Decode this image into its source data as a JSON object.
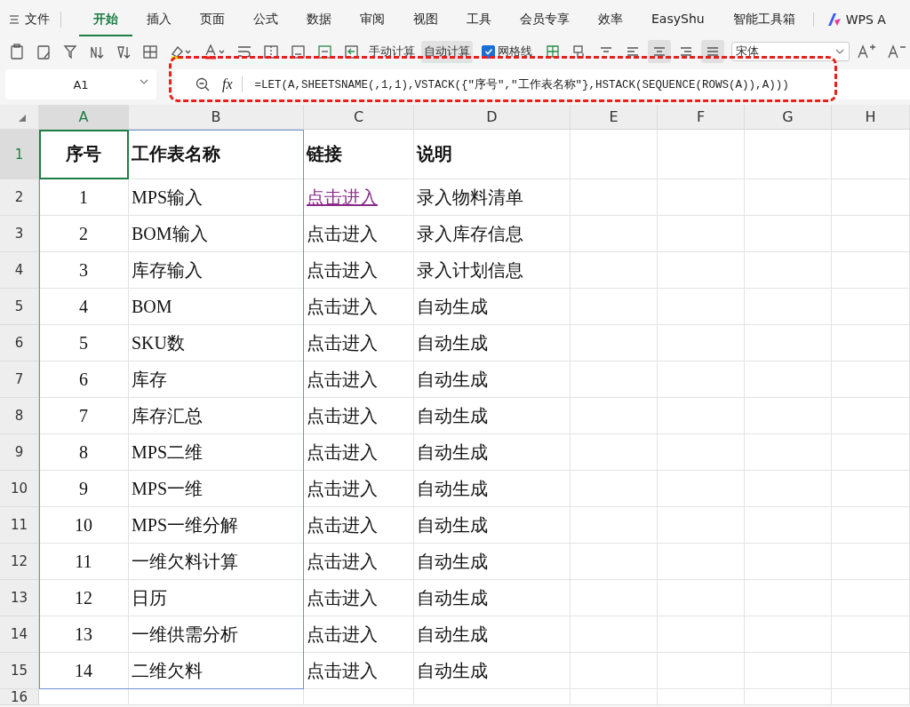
{
  "menu": {
    "file_label": "文件",
    "tabs": [
      {
        "label": "开始",
        "selected": true
      },
      {
        "label": "插入",
        "selected": false
      },
      {
        "label": "页面",
        "selected": false
      },
      {
        "label": "公式",
        "selected": false
      },
      {
        "label": "数据",
        "selected": false
      },
      {
        "label": "审阅",
        "selected": false
      },
      {
        "label": "视图",
        "selected": false
      },
      {
        "label": "工具",
        "selected": false
      },
      {
        "label": "会员专享",
        "selected": false
      },
      {
        "label": "效率",
        "selected": false
      },
      {
        "label": "EasyShu",
        "selected": false
      },
      {
        "label": "智能工具箱",
        "selected": false
      }
    ],
    "brand": "WPS A"
  },
  "toolbar": {
    "calc_buttons": [
      {
        "label": "手动计算",
        "selected": false
      },
      {
        "label": "自动计算",
        "selected": true
      }
    ],
    "gridlines": {
      "label": "网格线",
      "checked": true
    },
    "font": {
      "value": "宋体"
    }
  },
  "formula_bar": {
    "cell_ref": "A1",
    "fx_label": "fx",
    "formula": "=LET(A,SHEETSNAME(,1,1),VSTACK({\"序号\",\"工作表名称\"},HSTACK(SEQUENCE(ROWS(A)),A)))"
  },
  "annotation": {
    "kind": "dashed-outline"
  },
  "sheet": {
    "columns": [
      {
        "label": "A",
        "selected": true
      },
      {
        "label": "B",
        "selected": false
      },
      {
        "label": "C",
        "selected": false
      },
      {
        "label": "D",
        "selected": false
      },
      {
        "label": "E",
        "selected": false
      },
      {
        "label": "F",
        "selected": false
      },
      {
        "label": "G",
        "selected": false
      },
      {
        "label": "H",
        "selected": false
      }
    ],
    "header_row": {
      "number": "1",
      "selected": true,
      "cells": [
        "序号",
        "工作表名称",
        "链接",
        "说明"
      ]
    },
    "rows": [
      {
        "number": "2",
        "index": "1",
        "sheet": "MPS输入",
        "link": {
          "text": "点击进入",
          "visited": true
        },
        "note": "录入物料清单"
      },
      {
        "number": "3",
        "index": "2",
        "sheet": "BOM输入",
        "link": {
          "text": "点击进入",
          "visited": false
        },
        "note": "录入库存信息"
      },
      {
        "number": "4",
        "index": "3",
        "sheet": "库存输入",
        "link": {
          "text": "点击进入",
          "visited": false
        },
        "note": "录入计划信息"
      },
      {
        "number": "5",
        "index": "4",
        "sheet": "BOM",
        "link": {
          "text": "点击进入",
          "visited": false
        },
        "note": "自动生成"
      },
      {
        "number": "6",
        "index": "5",
        "sheet": "SKU数",
        "link": {
          "text": "点击进入",
          "visited": false
        },
        "note": "自动生成"
      },
      {
        "number": "7",
        "index": "6",
        "sheet": "库存",
        "link": {
          "text": "点击进入",
          "visited": false
        },
        "note": "自动生成"
      },
      {
        "number": "8",
        "index": "7",
        "sheet": "库存汇总",
        "link": {
          "text": "点击进入",
          "visited": false
        },
        "note": "自动生成"
      },
      {
        "number": "9",
        "index": "8",
        "sheet": "MPS二维",
        "link": {
          "text": "点击进入",
          "visited": false
        },
        "note": "自动生成"
      },
      {
        "number": "10",
        "index": "9",
        "sheet": "MPS一维",
        "link": {
          "text": "点击进入",
          "visited": false
        },
        "note": "自动生成"
      },
      {
        "number": "11",
        "index": "10",
        "sheet": "MPS一维分解",
        "link": {
          "text": "点击进入",
          "visited": false
        },
        "note": "自动生成"
      },
      {
        "number": "12",
        "index": "11",
        "sheet": "一维欠料计算",
        "link": {
          "text": "点击进入",
          "visited": false
        },
        "note": "自动生成"
      },
      {
        "number": "13",
        "index": "12",
        "sheet": "日历",
        "link": {
          "text": "点击进入",
          "visited": false
        },
        "note": "自动生成"
      },
      {
        "number": "14",
        "index": "13",
        "sheet": "一维供需分析",
        "link": {
          "text": "点击进入",
          "visited": false
        },
        "note": "自动生成"
      },
      {
        "number": "15",
        "index": "14",
        "sheet": "二维欠料",
        "link": {
          "text": "点击进入",
          "visited": false
        },
        "note": "自动生成"
      }
    ],
    "empty_rows": [
      {
        "number": "16"
      }
    ]
  }
}
